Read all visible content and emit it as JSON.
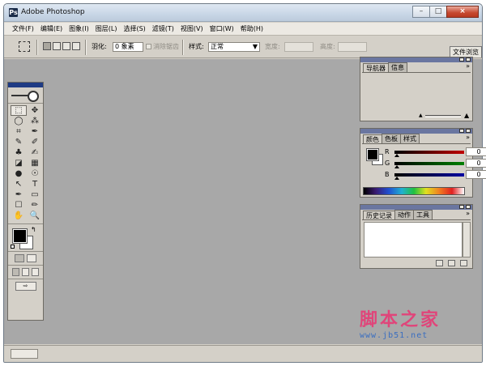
{
  "window": {
    "title": "Adobe Photoshop",
    "icon_letter": "Ps"
  },
  "window_controls": {
    "minimize": "–",
    "maximize": "□",
    "close": "×"
  },
  "menu": [
    "文件(F)",
    "编辑(E)",
    "图象(I)",
    "图层(L)",
    "选择(S)",
    "滤镜(T)",
    "视图(V)",
    "窗口(W)",
    "帮助(H)"
  ],
  "options_bar": {
    "feather_label": "羽化:",
    "feather_value": "0 象素",
    "antialias_label": "消除锯齿",
    "style_label": "样式:",
    "style_value": "正常",
    "width_label": "宽度:",
    "height_label": "高度:",
    "file_browser_tab": "文件浏览"
  },
  "navigator_palette": {
    "tabs": [
      "导航器",
      "信息"
    ],
    "menu_arrow": "»"
  },
  "color_palette": {
    "tabs": [
      "颜色",
      "色板",
      "样式"
    ],
    "menu_arrow": "»",
    "sliders": [
      {
        "label": "R",
        "value": "0",
        "color": "#c00000"
      },
      {
        "label": "G",
        "value": "0",
        "color": "#008000"
      },
      {
        "label": "B",
        "value": "0",
        "color": "#0000a0"
      }
    ]
  },
  "history_palette": {
    "tabs": [
      "历史记录",
      "动作",
      "工具"
    ],
    "menu_arrow": "»"
  },
  "tools": [
    "⬚",
    "✥",
    "◯",
    "⁂",
    "⌗",
    "✒",
    "✎",
    "✐",
    "♣",
    "✍",
    "◪",
    "▦",
    "●",
    "☉",
    "↖",
    "T",
    "✒",
    "▭",
    "☐",
    "✏",
    "✋",
    "🔍"
  ],
  "watermark": {
    "title": "脚本之家",
    "url": "www.jb51.net"
  }
}
